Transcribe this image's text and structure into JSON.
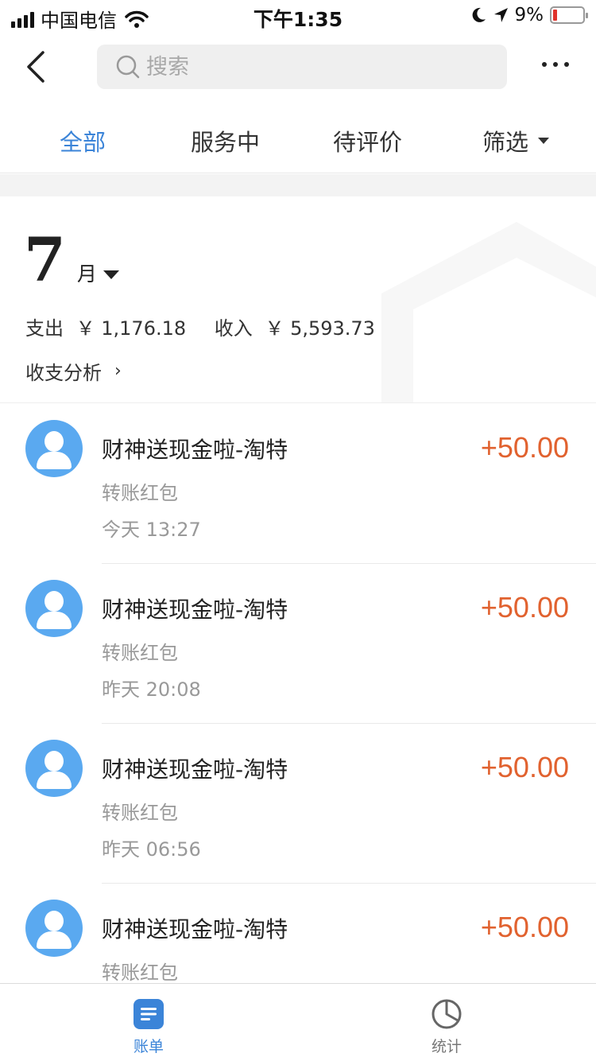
{
  "status_bar": {
    "carrier": "中国电信",
    "time": "下午1:35",
    "battery": "9%",
    "battery_level": 0.09
  },
  "header": {
    "search_placeholder": "搜索"
  },
  "tabs": [
    {
      "label": "全部",
      "active": true
    },
    {
      "label": "服务中",
      "active": false
    },
    {
      "label": "待评价",
      "active": false
    },
    {
      "label": "筛选",
      "active": false
    }
  ],
  "summary": {
    "month": "7",
    "month_unit": "月",
    "expense_label": "支出",
    "expense_value": "￥ 1,176.18",
    "income_label": "收入",
    "income_value": "￥ 5,593.73",
    "analysis_label": "收支分析",
    "analysis_chevron": "›"
  },
  "transactions": [
    {
      "title": "财神送现金啦-淘特",
      "type": "转账红包",
      "time": "今天  13:27",
      "amount": "+50.00"
    },
    {
      "title": "财神送现金啦-淘特",
      "type": "转账红包",
      "time": "昨天  20:08",
      "amount": "+50.00"
    },
    {
      "title": "财神送现金啦-淘特",
      "type": "转账红包",
      "time": "昨天  06:56",
      "amount": "+50.00"
    },
    {
      "title": "财神送现金啦-淘特",
      "type": "转账红包",
      "time": "",
      "amount": "+50.00"
    }
  ],
  "tabbar": {
    "bill_label": "账单",
    "stats_label": "统计"
  },
  "colors": {
    "accent": "#3b84d8",
    "amount": "#e1622f",
    "avatar": "#5aa9f0"
  },
  "icons": [
    "signal-icon",
    "wifi-icon",
    "moon-icon",
    "location-arrow-icon",
    "battery-icon",
    "back-icon",
    "search-icon",
    "more-icon",
    "dropdown-caret-icon",
    "avatar-icon",
    "bill-icon",
    "pie-chart-icon"
  ]
}
